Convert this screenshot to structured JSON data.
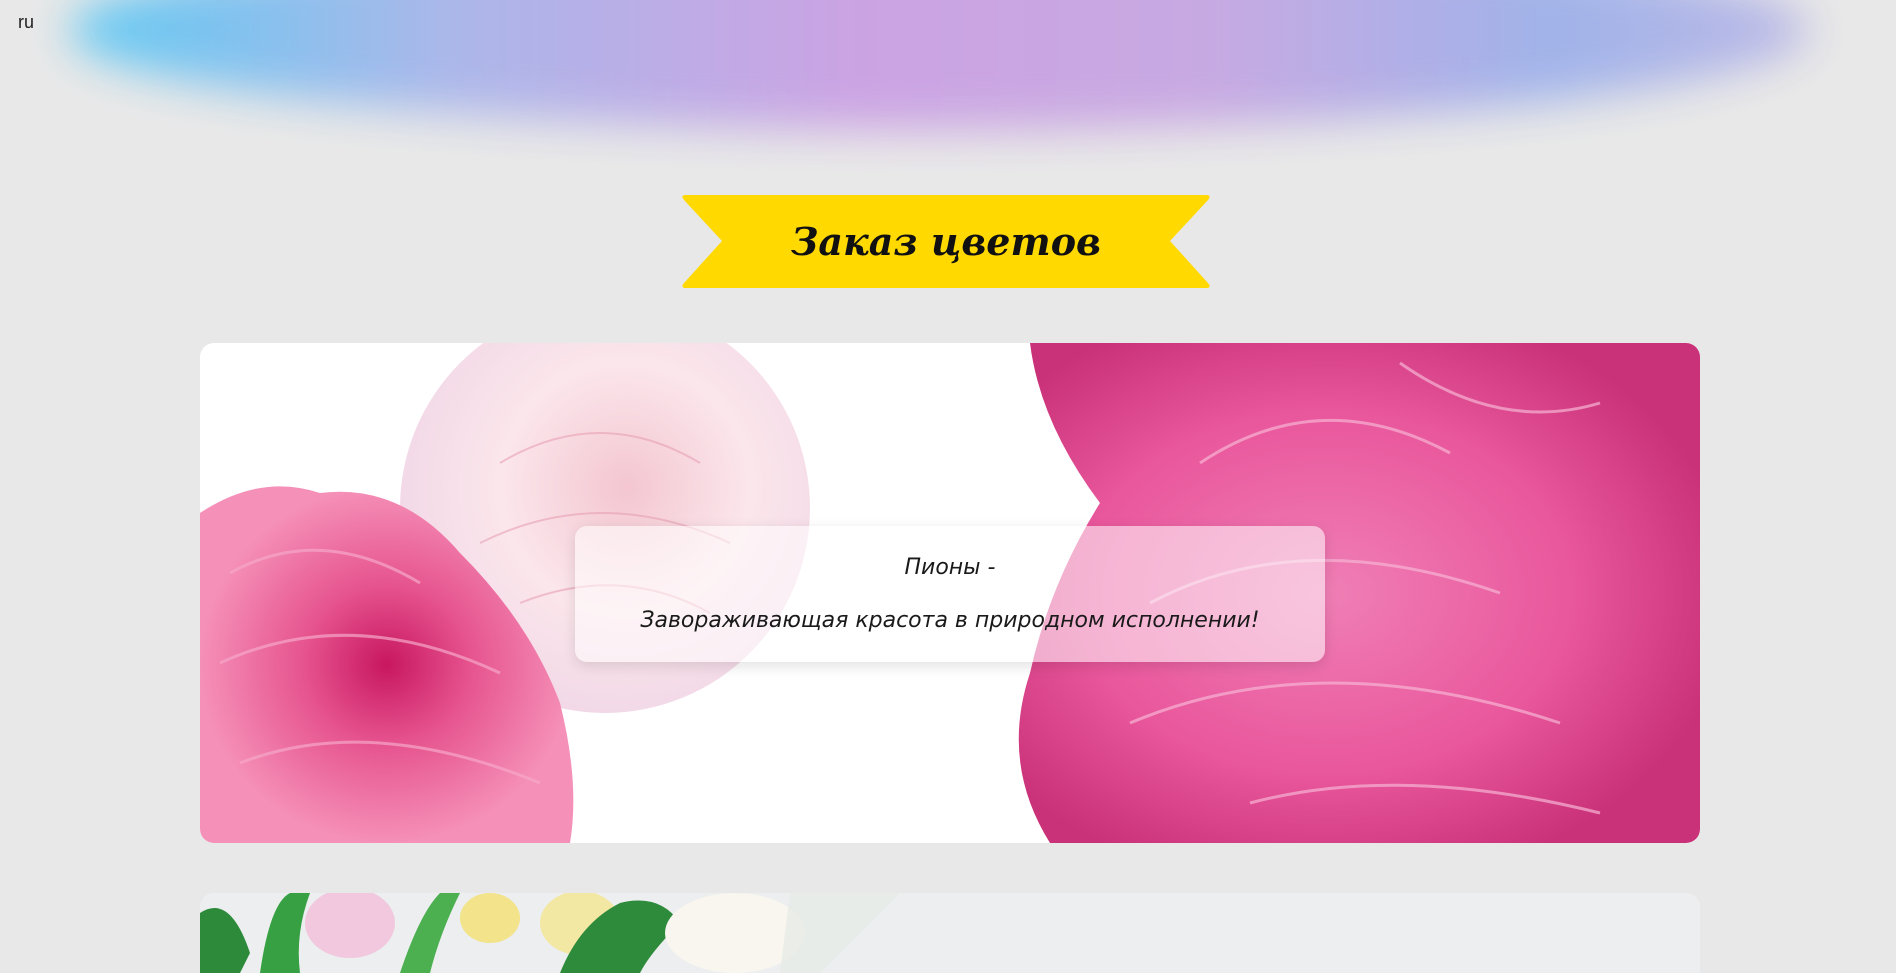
{
  "header": {
    "lang": "ru"
  },
  "banner": {
    "title": "Заказ цветов"
  },
  "cards": [
    {
      "title": "Пионы -",
      "text": "Завораживающая красота в природном исполнении!",
      "image": "peony-image"
    },
    {
      "image": "tulips-image"
    }
  ],
  "colors": {
    "page_background": "#e8e8e8",
    "ribbon": "#ffd900",
    "peony_pink": "#e8559a"
  }
}
